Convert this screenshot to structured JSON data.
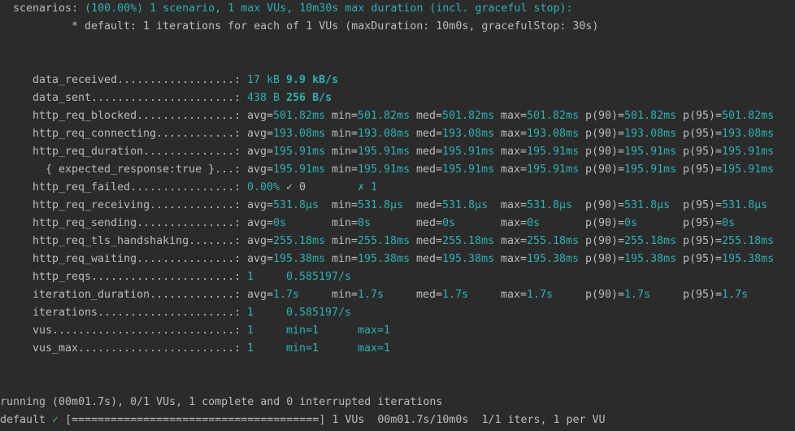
{
  "header": {
    "scenarios_label": "scenarios:",
    "scenarios_summary": "(100.00%) 1 scenario, 1 max VUs, 10m30s max duration (incl. graceful stop):",
    "default_line": "* default: 1 iterations for each of 1 VUs (maxDuration: 10m0s, gracefulStop: 30s)"
  },
  "metrics": {
    "data_received": {
      "name": "data_received..................:",
      "v1": "17 kB",
      "v2": "9.9 kB/s"
    },
    "data_sent": {
      "name": "data_sent......................:",
      "v1": "438 B",
      "v2": "256 B/s"
    },
    "http_req_blocked": {
      "name": "http_req_blocked...............:",
      "avg": "501.82ms",
      "min": "501.82ms",
      "med": "501.82ms",
      "max": "501.82ms",
      "p90": "501.82ms",
      "p95": "501.82ms"
    },
    "http_req_connecting": {
      "name": "http_req_connecting............:",
      "avg": "193.08ms",
      "min": "193.08ms",
      "med": "193.08ms",
      "max": "193.08ms",
      "p90": "193.08ms",
      "p95": "193.08ms"
    },
    "http_req_duration": {
      "name": "http_req_duration..............:",
      "avg": "195.91ms",
      "min": "195.91ms",
      "med": "195.91ms",
      "max": "195.91ms",
      "p90": "195.91ms",
      "p95": "195.91ms"
    },
    "expected_response": {
      "name": "  { expected_response:true }...:",
      "avg": "195.91ms",
      "min": "195.91ms",
      "med": "195.91ms",
      "max": "195.91ms",
      "p90": "195.91ms",
      "p95": "195.91ms"
    },
    "http_req_failed": {
      "name": "http_req_failed................:",
      "rate": "0.00%",
      "pass": "✓ 0",
      "fail": "✗ 1"
    },
    "http_req_receiving": {
      "name": "http_req_receiving.............:",
      "avg": "531.8µs",
      "min": "531.8µs",
      "med": "531.8µs",
      "max": "531.8µs",
      "p90": "531.8µs",
      "p95": "531.8µs"
    },
    "http_req_sending": {
      "name": "http_req_sending...............:",
      "avg": "0s",
      "min": "0s",
      "med": "0s",
      "max": "0s",
      "p90": "0s",
      "p95": "0s"
    },
    "http_req_tls_handshaking": {
      "name": "http_req_tls_handshaking.......:",
      "avg": "255.18ms",
      "min": "255.18ms",
      "med": "255.18ms",
      "max": "255.18ms",
      "p90": "255.18ms",
      "p95": "255.18ms"
    },
    "http_req_waiting": {
      "name": "http_req_waiting...............:",
      "avg": "195.38ms",
      "min": "195.38ms",
      "med": "195.38ms",
      "max": "195.38ms",
      "p90": "195.38ms",
      "p95": "195.38ms"
    },
    "http_reqs": {
      "name": "http_reqs......................:",
      "count": "1",
      "rate": "0.585197/s"
    },
    "iteration_duration": {
      "name": "iteration_duration.............:",
      "avg": "1.7s",
      "min": "1.7s",
      "med": "1.7s",
      "max": "1.7s",
      "p90": "1.7s",
      "p95": "1.7s"
    },
    "iterations": {
      "name": "iterations.....................:",
      "count": "1",
      "rate": "0.585197/s"
    },
    "vus": {
      "name": "vus............................:",
      "value": "1",
      "min": "1",
      "max": "1"
    },
    "vus_max": {
      "name": "vus_max........................:",
      "value": "1",
      "min": "1",
      "max": "1"
    }
  },
  "labels": {
    "avg": "avg=",
    "min": "min=",
    "med": "med=",
    "max": "max=",
    "p90": "p(90)=",
    "p95": "p(95)="
  },
  "footer": {
    "running": "running (00m01.7s), 0/1 VUs, 1 complete and 0 interrupted iterations",
    "default_label": "default",
    "check": "✓",
    "progress": "[======================================]",
    "progress_stats": "1 VUs  00m01.7s/10m0s  1/1 iters, 1 per VU"
  }
}
